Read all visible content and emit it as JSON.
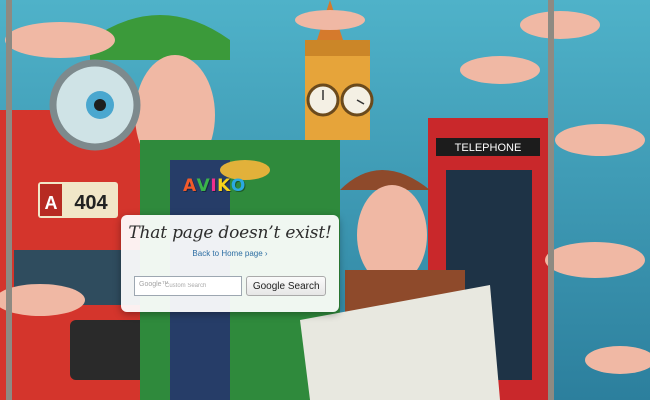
{
  "logo": {
    "letters": [
      "A",
      "V",
      "I",
      "K",
      "O"
    ],
    "colors": [
      "#f25a2a",
      "#3ab54a",
      "#ee2e8d",
      "#f8d21a",
      "#2aa9e0"
    ]
  },
  "scene": {
    "bus_number": "404",
    "bus_letter": "A",
    "phone_box_sign": "TELEPHONE"
  },
  "error_card": {
    "title": "That page doesn’t exist!",
    "home_link": "Back to Home page ›"
  },
  "search": {
    "google_word": "Google™",
    "placeholder": "Custom Search",
    "button_label": "Google Search"
  }
}
